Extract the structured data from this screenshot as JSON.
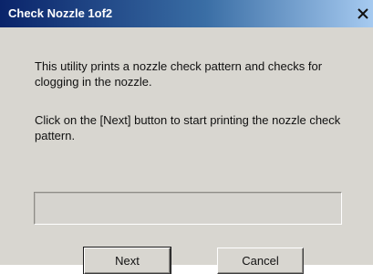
{
  "window": {
    "title": "Check Nozzle 1of2",
    "close_glyph": "X",
    "close_icon": "close-icon"
  },
  "content": {
    "description": "This utility prints a nozzle check pattern and checks for clogging in the nozzle.",
    "instruction": "Click on the [Next] button to start printing the nozzle check pattern."
  },
  "progress": {
    "value": 0
  },
  "buttons": {
    "next_label": "Next",
    "cancel_label": "Cancel"
  },
  "colors": {
    "titlebar_start": "#0a246a",
    "titlebar_end": "#a6caf0",
    "dialog_bg": "#d8d6d0"
  }
}
